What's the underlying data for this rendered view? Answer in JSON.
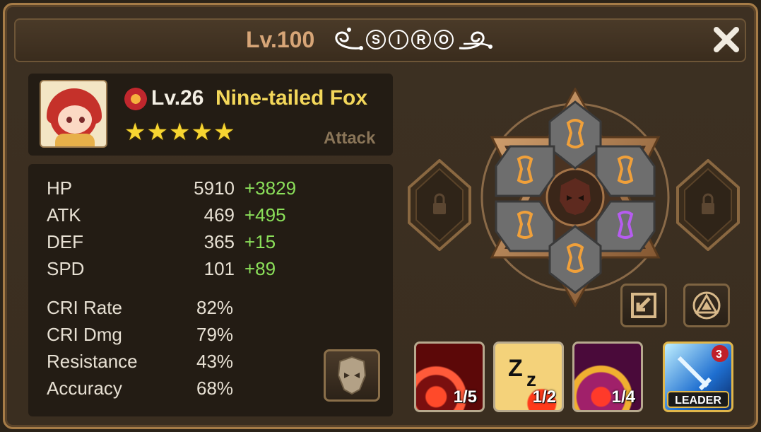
{
  "header": {
    "level": "Lv.100",
    "rune_letters": [
      "S",
      "I",
      "R",
      "O"
    ]
  },
  "monster": {
    "level": "Lv.26",
    "name": "Nine-tailed Fox",
    "type": "Attack",
    "stars": 5,
    "element": "fire"
  },
  "stats": [
    {
      "label": "HP",
      "base": "5910",
      "bonus": "+3829"
    },
    {
      "label": "ATK",
      "base": "469",
      "bonus": "+495"
    },
    {
      "label": "DEF",
      "base": "365",
      "bonus": "+15"
    },
    {
      "label": "SPD",
      "base": "101",
      "bonus": "+89"
    }
  ],
  "extra_stats": [
    {
      "label": "CRI Rate",
      "value": "82%"
    },
    {
      "label": "CRI Dmg",
      "value": "79%"
    },
    {
      "label": "Resistance",
      "value": "43%"
    },
    {
      "label": "Accuracy",
      "value": "68%"
    }
  ],
  "skills": [
    {
      "level": "1/5",
      "icon": "fire-burst-icon"
    },
    {
      "level": "1/2",
      "icon": "sleep-zzz-icon"
    },
    {
      "level": "1/4",
      "icon": "purple-burst-icon"
    }
  ],
  "leader_skill": {
    "label": "LEADER",
    "badge": "3"
  },
  "colors": {
    "gold_text": "#f3d75a",
    "bonus_green": "#8be05a",
    "stat_text": "#e7e0d3",
    "title_copper": "#d7a577"
  }
}
